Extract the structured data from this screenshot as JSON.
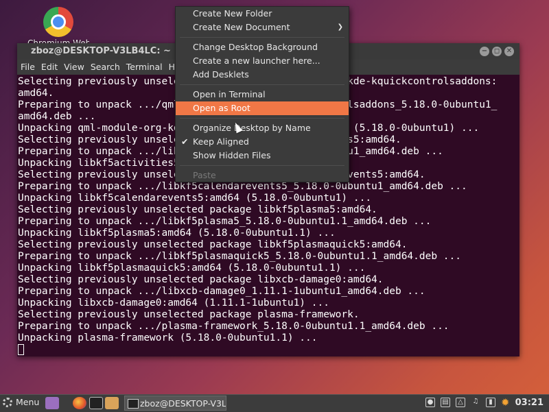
{
  "desktop": {
    "icon_label": "Chromium Web..."
  },
  "terminal": {
    "title": "zboz@DESKTOP-V3LB4LC: ~",
    "menu": [
      "File",
      "Edit",
      "View",
      "Search",
      "Terminal",
      "Help"
    ],
    "lines": [
      "Selecting previously unselected package qml-module-org-kde-kquickcontrolsaddons:",
      "amd64.",
      "Preparing to unpack .../qml-module-org-kde-kquickcontrolsaddons_5.18.0-0ubuntu1_",
      "amd64.deb ...",
      "Unpacking qml-module-org-kde-kquickcontrolsaddons:amd64 (5.18.0-0ubuntu1) ...",
      "Selecting previously unselected package libkf5activities5:amd64.",
      "Preparing to unpack .../libkf5activities5_5.18.0-0ubuntu1_amd64.deb ...",
      "Unpacking libkf5activities5:amd64 (5.18.0-0ubuntu1) ...",
      "Selecting previously unselected package libkf5calendarevents5:amd64.",
      "Preparing to unpack .../libkf5calendarevents5_5.18.0-0ubuntu1_amd64.deb ...",
      "Unpacking libkf5calendarevents5:amd64 (5.18.0-0ubuntu1) ...",
      "Selecting previously unselected package libkf5plasma5:amd64.",
      "Preparing to unpack .../libkf5plasma5_5.18.0-0ubuntu1.1_amd64.deb ...",
      "Unpacking libkf5plasma5:amd64 (5.18.0-0ubuntu1.1) ...",
      "Selecting previously unselected package libkf5plasmaquick5:amd64.",
      "Preparing to unpack .../libkf5plasmaquick5_5.18.0-0ubuntu1.1_amd64.deb ...",
      "Unpacking libkf5plasmaquick5:amd64 (5.18.0-0ubuntu1.1) ...",
      "Selecting previously unselected package libxcb-damage0:amd64.",
      "Preparing to unpack .../libxcb-damage0_1.11.1-1ubuntu1_amd64.deb ...",
      "Unpacking libxcb-damage0:amd64 (1.11.1-1ubuntu1) ...",
      "Selecting previously unselected package plasma-framework.",
      "Preparing to unpack .../plasma-framework_5.18.0-0ubuntu1.1_amd64.deb ...",
      "Unpacking plasma-framework (5.18.0-0ubuntu1.1) ..."
    ]
  },
  "context_menu": {
    "items": [
      {
        "label": "Create New Folder"
      },
      {
        "label": "Create New Document",
        "submenu": true
      },
      {
        "sep": true
      },
      {
        "label": "Change Desktop Background"
      },
      {
        "label": "Create a new launcher here..."
      },
      {
        "label": "Add Desklets"
      },
      {
        "sep": true
      },
      {
        "label": "Open in Terminal"
      },
      {
        "label": "Open as Root",
        "highlighted": true
      },
      {
        "sep": true
      },
      {
        "label": "Organize Desktop by Name"
      },
      {
        "label": "Keep Aligned",
        "checked": true
      },
      {
        "label": "Show Hidden Files"
      },
      {
        "sep": true
      },
      {
        "label": "Paste",
        "disabled": true
      }
    ]
  },
  "taskbar": {
    "menu_label": "Menu",
    "task_label": "zboz@DESKTOP-V3L...",
    "clock": "03:21"
  },
  "colors": {
    "highlight": "#f07746",
    "terminal_bg": "#2f0a24"
  }
}
